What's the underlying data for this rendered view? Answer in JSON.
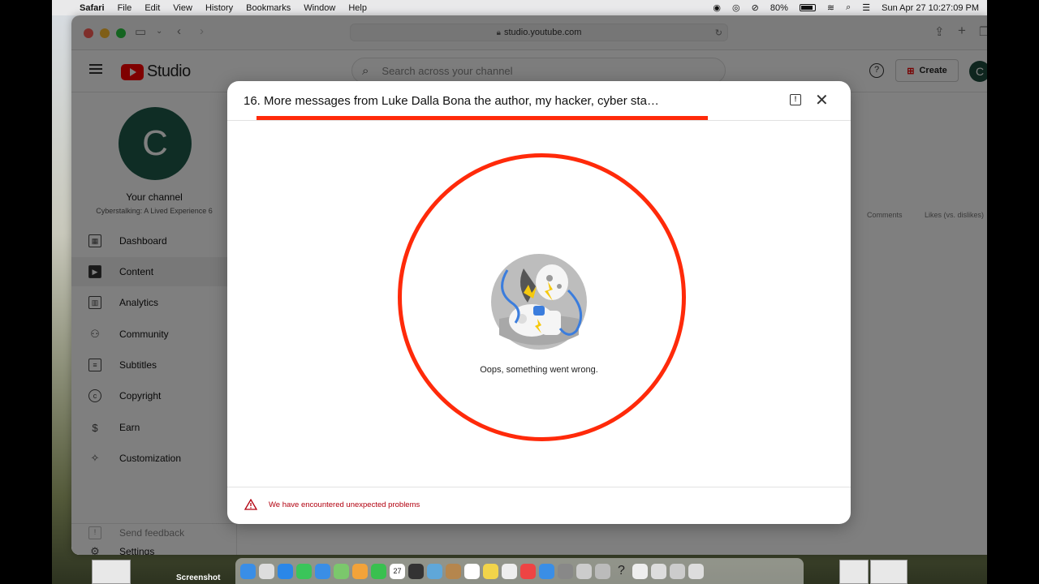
{
  "menubar": {
    "app": "Safari",
    "items": [
      "File",
      "Edit",
      "View",
      "History",
      "Bookmarks",
      "Window",
      "Help"
    ],
    "battery": "80%",
    "datetime": "Sun Apr 27  10:27:09 PM"
  },
  "browser": {
    "url": "studio.youtube.com"
  },
  "studio": {
    "logo_text": "Studio",
    "search_placeholder": "Search across your channel",
    "help": "?",
    "create_label": "Create",
    "avatar_initial": "C",
    "channel": {
      "initial": "C",
      "title": "Your channel",
      "name": "Cyberstalking: A Lived Experience 6"
    },
    "nav": [
      {
        "label": "Dashboard",
        "icon": "dashboard-icon",
        "active": false
      },
      {
        "label": "Content",
        "icon": "content-icon",
        "active": true
      },
      {
        "label": "Analytics",
        "icon": "analytics-icon",
        "active": false
      },
      {
        "label": "Community",
        "icon": "community-icon",
        "active": false
      },
      {
        "label": "Subtitles",
        "icon": "subtitles-icon",
        "active": false
      },
      {
        "label": "Copyright",
        "icon": "copyright-icon",
        "active": false
      },
      {
        "label": "Earn",
        "icon": "dollar-icon",
        "active": false
      },
      {
        "label": "Customization",
        "icon": "magic-wand-icon",
        "active": false
      }
    ],
    "nav_bottom": [
      {
        "label": "Settings",
        "icon": "gear-icon"
      },
      {
        "label": "Send feedback",
        "icon": "feedback-icon"
      }
    ],
    "columns": [
      "Comments",
      "Likes (vs. dislikes)"
    ]
  },
  "modal": {
    "title": "16. More messages from Luke Dalla Bona the author, my hacker, cyber sta…",
    "error_message": "Oops, something went wrong.",
    "footer_warning": "We have encountered unexpected problems"
  },
  "dock": {
    "label": "Screenshot",
    "calendar_day": "27"
  },
  "colors": {
    "annotation_red": "#ff2a0a",
    "warning_red": "#b2000f",
    "avatar_green": "#1f5a4a"
  }
}
